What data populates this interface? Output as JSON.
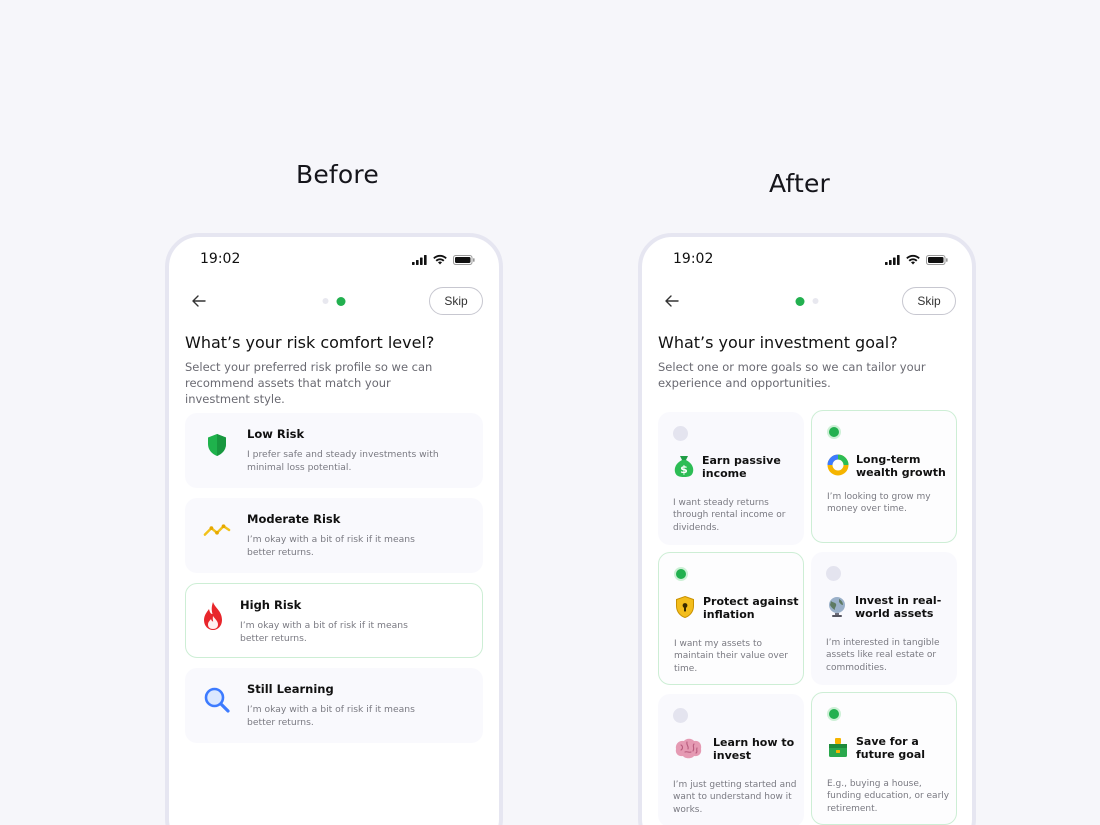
{
  "labels": {
    "before": "Before",
    "after": "After"
  },
  "colors": {
    "accent": "#22b04f",
    "background": "#f6f6fa",
    "card": "#f9f9fd",
    "selected_border": "#cdeed5"
  },
  "before_screen": {
    "status_time": "19:02",
    "skip_label": "Skip",
    "title": "What’s your risk comfort level?",
    "subtitle": "Select your preferred risk profile so we can recommend assets that match your investment style.",
    "options": [
      {
        "name": "Low Risk",
        "desc": "I prefer safe and steady investments with minimal loss potential.",
        "icon": "shield-icon",
        "selected": false
      },
      {
        "name": "Moderate Risk",
        "desc": "I’m okay with a bit of risk if it means better returns.",
        "icon": "trend-line-icon",
        "selected": false
      },
      {
        "name": "High Risk",
        "desc": "I’m okay with a bit of risk if it means better returns.",
        "icon": "fire-icon",
        "selected": true
      },
      {
        "name": "Still Learning",
        "desc": "I’m okay with a bit of risk if it means better returns.",
        "icon": "magnifier-icon",
        "selected": false
      }
    ]
  },
  "after_screen": {
    "status_time": "19:02",
    "skip_label": "Skip",
    "title": "What’s your investment goal?",
    "subtitle": "Select one or more goals so we can tailor your experience and opportunities.",
    "goals": [
      {
        "name": "Earn passive income",
        "desc": "I want steady returns through rental income or dividends.",
        "icon": "money-bag-icon",
        "selected": false
      },
      {
        "name": "Long-term wealth growth",
        "desc": "I’m looking to grow my money over time.",
        "icon": "donut-chart-icon",
        "selected": true
      },
      {
        "name": "Protect against inflation",
        "desc": "I want my assets to maintain their value over time.",
        "icon": "shield-lock-icon",
        "selected": true
      },
      {
        "name": "Invest in real-world assets",
        "desc": "I’m interested in tangible assets like real estate or commodities.",
        "icon": "globe-icon",
        "selected": false
      },
      {
        "name": "Learn how to invest",
        "desc": "I’m just getting started and want to understand how it works.",
        "icon": "brain-icon",
        "selected": false
      },
      {
        "name": "Save for a future goal",
        "desc": "E.g., buying a house, funding education, or early retirement.",
        "icon": "savings-box-icon",
        "selected": true
      }
    ]
  }
}
